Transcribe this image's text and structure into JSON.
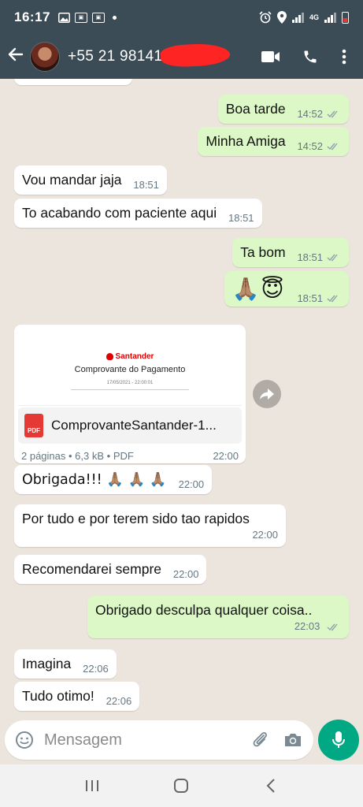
{
  "status_bar": {
    "time": "16:17",
    "network": "4G"
  },
  "header": {
    "contact_name": "+55 21 98141-",
    "icons": [
      "back-arrow-icon",
      "video-call-icon",
      "phone-call-icon",
      "more-vert-icon"
    ]
  },
  "messages": [
    {
      "dir": "out",
      "text": "Boa tarde",
      "time": "14:52",
      "read": true
    },
    {
      "dir": "out",
      "text": "Minha Amiga",
      "time": "14:52",
      "read": true
    },
    {
      "dir": "in",
      "text": "Vou mandar jaja",
      "time": "18:51"
    },
    {
      "dir": "in",
      "text": "To acabando com paciente aqui",
      "time": "18:51"
    },
    {
      "dir": "out",
      "text": "Ta bom",
      "time": "18:51",
      "read": true
    },
    {
      "dir": "out",
      "text": "🙏🏽😇",
      "time": "18:51",
      "read": true
    },
    {
      "dir": "in",
      "text": "Obrigada!!! 🙏🏽 🙏🏽 🙏🏽",
      "time": "22:00"
    },
    {
      "dir": "in",
      "text": "Por tudo e por terem sido tao rapidos",
      "time": "22:00"
    },
    {
      "dir": "in",
      "text": "Recomendarei sempre",
      "time": "22:00"
    },
    {
      "dir": "out",
      "text": "Obrigado desculpa qualquer coisa..",
      "time": "22:03",
      "read": true
    },
    {
      "dir": "in",
      "text": "Imagina",
      "time": "22:06"
    },
    {
      "dir": "in",
      "text": "Tudo otimo!",
      "time": "22:06"
    }
  ],
  "document": {
    "preview_brand": "Santander",
    "preview_title": "Comprovante do Pagamento",
    "preview_date": "17/05/2021 - 22:00:01",
    "file_badge": "PDF",
    "file_name": "ComprovanteSantander-1...",
    "pages": "2 páginas",
    "size": "6,3 kB",
    "type": "PDF",
    "time": "22:00"
  },
  "composer": {
    "placeholder": "Mensagem"
  },
  "colors": {
    "header_bg": "#3b4c56",
    "chat_bg": "#ece5dd",
    "outgoing_bubble": "#dcf8c6",
    "incoming_bubble": "#ffffff",
    "read_tick": "#53bdeb",
    "mic_button": "#00a884"
  }
}
